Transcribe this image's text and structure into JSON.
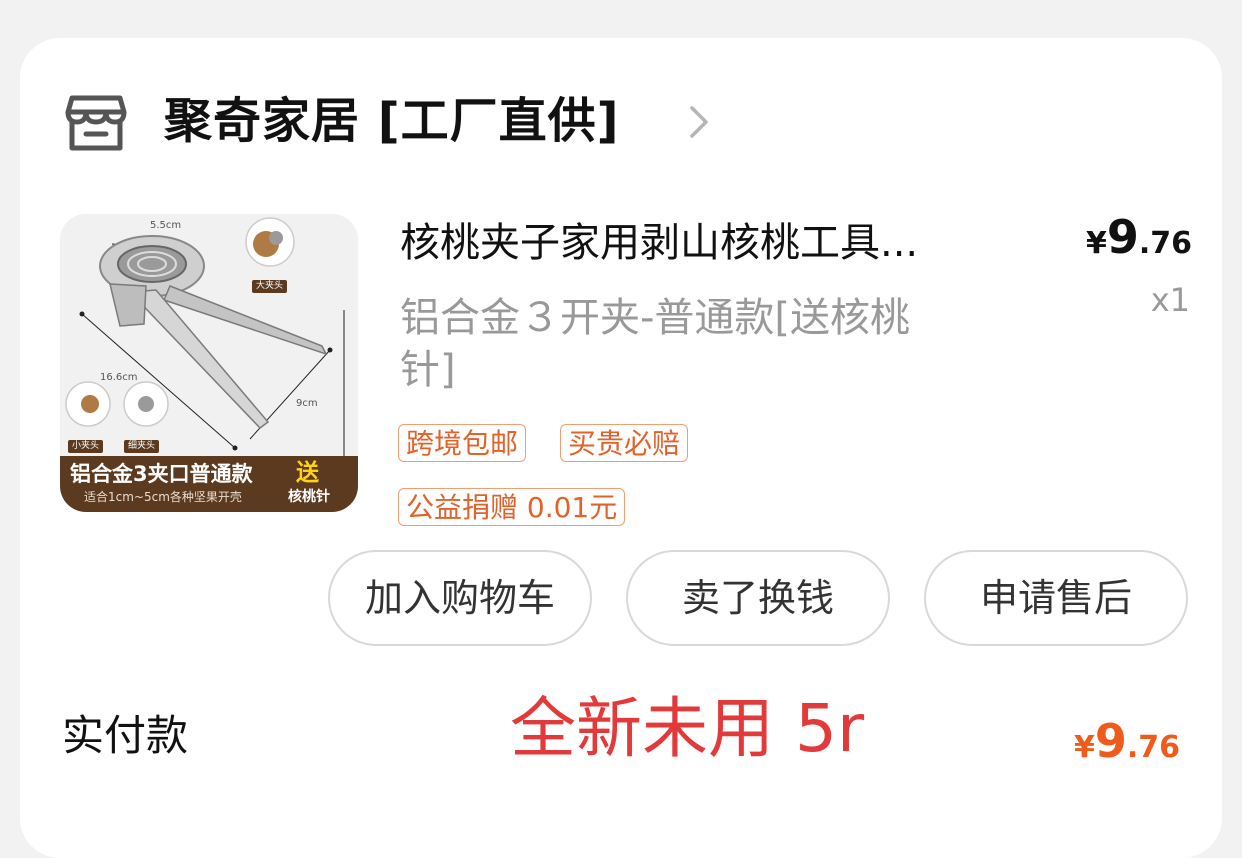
{
  "shop": {
    "name": "聚奇家居 [工厂直供]",
    "icon": "store-icon",
    "chevron": "chevron-right-icon"
  },
  "product": {
    "title": "核桃夹子家用剥山核桃工具...",
    "variant": "铝合金３开夹-普通款[送核桃针]",
    "price_symbol": "¥",
    "price_int": "9",
    "price_dec": ".76",
    "quantity": "x1",
    "tags": [
      "跨境包邮",
      "买贵必赔",
      "公益捐赠 0.01元"
    ],
    "image": {
      "caption_title": "铝合金3夹口普通款",
      "caption_send": "送",
      "caption_sub": "适合1cm~5cm各种坚果开壳",
      "caption_pin": "核桃针",
      "dim_top": "5.5cm",
      "dim_length": "16.6cm",
      "dim_height": "9cm",
      "tag_large": "大夹头",
      "tag_small": "小夹头",
      "tag_thin": "细夹头"
    }
  },
  "actions": {
    "add_to_cart": "加入购物车",
    "sell_for_cash": "卖了换钱",
    "after_sales": "申请售后"
  },
  "payment": {
    "label": "实付款",
    "price_symbol": "¥",
    "price_int": "9",
    "price_dec": ".76"
  },
  "annotation": "全新未用 5r",
  "colors": {
    "accent": "#f05a1a",
    "tag_text": "#e2622a",
    "annotation": "#e23a3a",
    "caption_bg": "#5b3a20"
  }
}
